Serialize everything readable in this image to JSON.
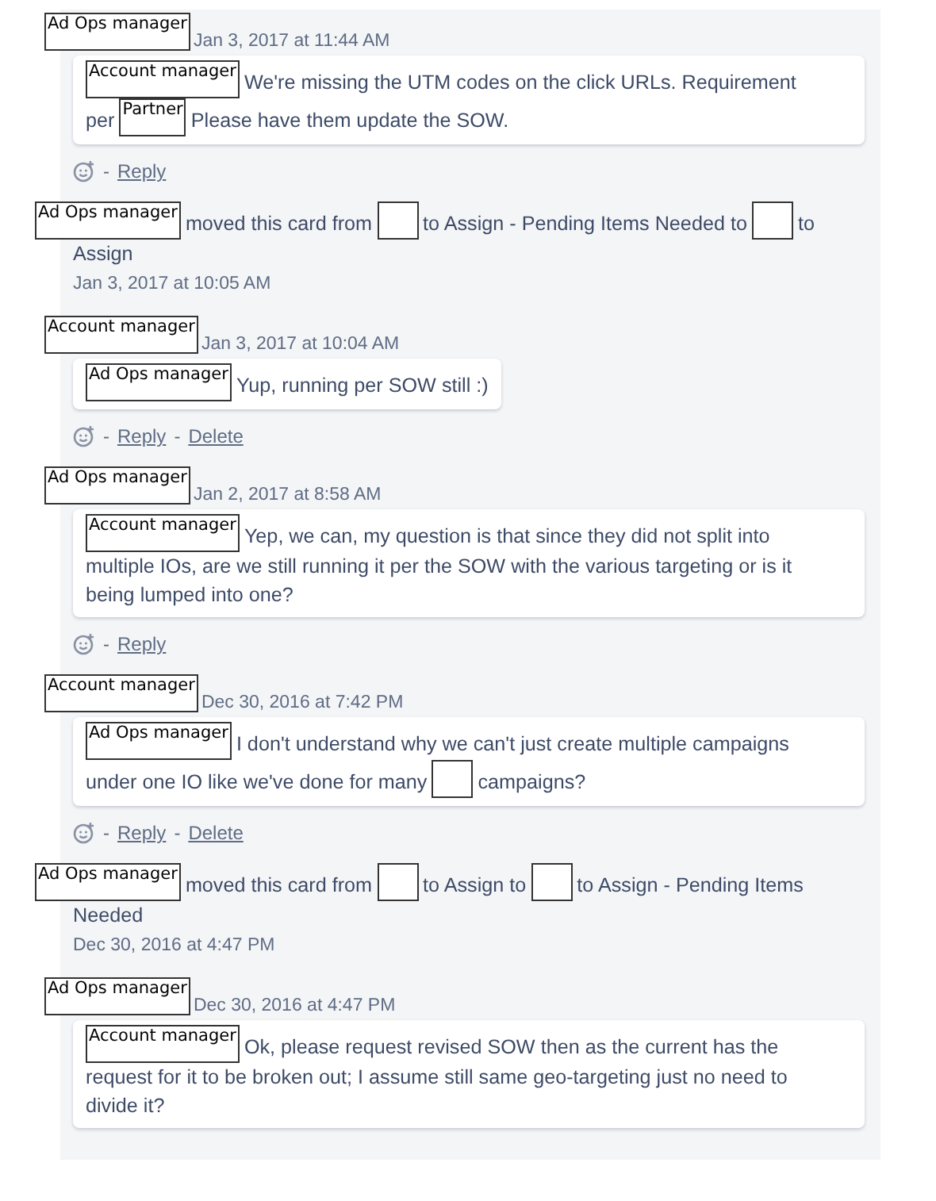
{
  "activity": [
    {
      "kind": "comment",
      "author": "Ad Ops manager",
      "date": "Jan 3, 2017 at 11:44 AM",
      "lines": [
        [
          {
            "kind": "tag",
            "text": "Account manager"
          },
          {
            "kind": "text",
            "text": "We're missing the UTM codes on the click URLs. Requirement"
          }
        ],
        [
          {
            "kind": "text",
            "text": "per"
          },
          {
            "kind": "tag",
            "text": "Partner"
          },
          {
            "kind": "text",
            "text": "Please have them update the SOW."
          }
        ]
      ],
      "footer": [
        {
          "kind": "icon"
        },
        {
          "kind": "sep",
          "text": "-"
        },
        {
          "kind": "link",
          "text": "Reply"
        }
      ]
    },
    {
      "kind": "move",
      "author": "Ad Ops manager",
      "lines": [
        [
          {
            "kind": "text",
            "text": "moved this card from"
          },
          {
            "kind": "blank"
          },
          {
            "kind": "text",
            "text": "to Assign - Pending Items Needed to"
          },
          {
            "kind": "blank"
          },
          {
            "kind": "text",
            "text": "to"
          }
        ],
        [
          {
            "kind": "text",
            "text": "Assign"
          }
        ]
      ],
      "date": "Jan 3, 2017 at 10:05 AM"
    },
    {
      "kind": "comment",
      "author": "Account manager",
      "date": "Jan 3, 2017 at 10:04 AM",
      "lines": [
        [
          {
            "kind": "tag",
            "text": "Ad Ops manager"
          },
          {
            "kind": "text",
            "text": "Yup, running per SOW still :)"
          }
        ]
      ],
      "footer": [
        {
          "kind": "icon"
        },
        {
          "kind": "sep",
          "text": "-"
        },
        {
          "kind": "link",
          "text": "Reply"
        },
        {
          "kind": "sep",
          "text": "-"
        },
        {
          "kind": "link",
          "text": "Delete"
        }
      ]
    },
    {
      "kind": "comment",
      "author": "Ad Ops manager",
      "date": "Jan 2, 2017 at 8:58 AM",
      "lines": [
        [
          {
            "kind": "tag",
            "text": "Account manager"
          },
          {
            "kind": "text",
            "text": "Yep, we can, my question is that since they did not split into"
          }
        ],
        [
          {
            "kind": "text",
            "text": "multiple IOs, are we still running it per the SOW with the various targeting or is it"
          }
        ],
        [
          {
            "kind": "text",
            "text": "being lumped into one?"
          }
        ]
      ],
      "footer": [
        {
          "kind": "icon"
        },
        {
          "kind": "sep",
          "text": "-"
        },
        {
          "kind": "link",
          "text": "Reply"
        }
      ]
    },
    {
      "kind": "comment",
      "author": "Account manager",
      "date": "Dec 30, 2016 at 7:42 PM",
      "lines": [
        [
          {
            "kind": "tag",
            "text": "Ad Ops manager"
          },
          {
            "kind": "text",
            "text": "I don't understand why we can't just create multiple campaigns"
          }
        ],
        [
          {
            "kind": "text",
            "text": "under one IO like we've done for many"
          },
          {
            "kind": "blank"
          },
          {
            "kind": "text",
            "text": "campaigns?"
          }
        ]
      ],
      "footer": [
        {
          "kind": "icon"
        },
        {
          "kind": "sep",
          "text": "-"
        },
        {
          "kind": "link",
          "text": "Reply"
        },
        {
          "kind": "sep",
          "text": "-"
        },
        {
          "kind": "link",
          "text": "Delete"
        }
      ]
    },
    {
      "kind": "move",
      "author": "Ad Ops manager",
      "lines": [
        [
          {
            "kind": "text",
            "text": "moved this card from"
          },
          {
            "kind": "blank"
          },
          {
            "kind": "text",
            "text": "to Assign to"
          },
          {
            "kind": "blank"
          },
          {
            "kind": "text",
            "text": "to Assign - Pending Items"
          }
        ],
        [
          {
            "kind": "text",
            "text": "Needed"
          }
        ]
      ],
      "date": "Dec 30, 2016 at 4:47 PM"
    },
    {
      "kind": "comment",
      "author": "Ad Ops manager",
      "date": "Dec 30, 2016 at 4:47 PM",
      "lines": [
        [
          {
            "kind": "tag",
            "text": "Account manager"
          },
          {
            "kind": "text",
            "text": "Ok, please request revised SOW then as the current has the"
          }
        ],
        [
          {
            "kind": "text",
            "text": "request for it to be broken out; I assume still same geo-targeting just no need to"
          }
        ],
        [
          {
            "kind": "text",
            "text": "divide it?"
          }
        ]
      ]
    }
  ]
}
